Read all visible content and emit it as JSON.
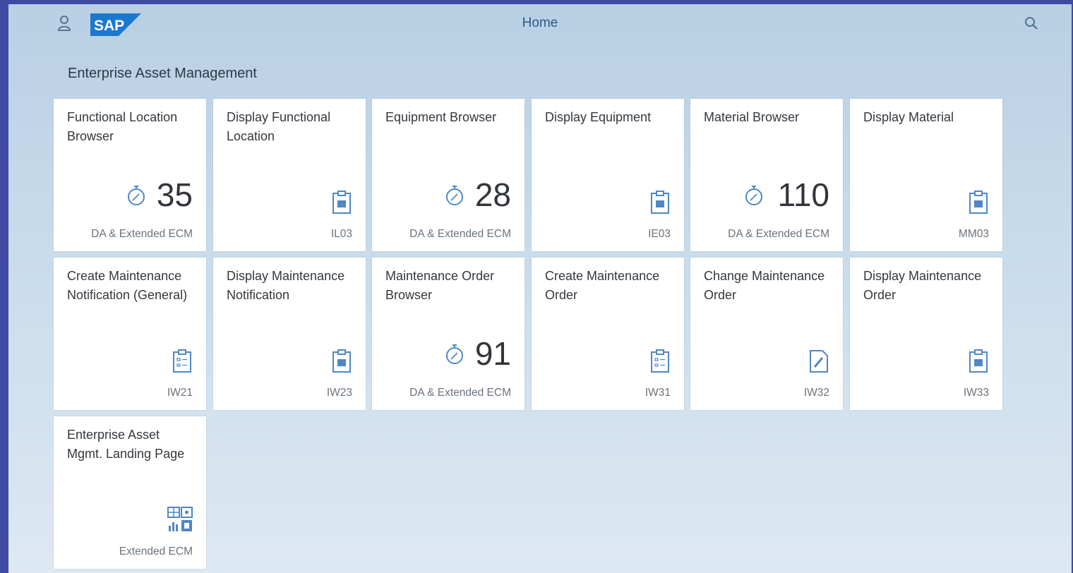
{
  "shell": {
    "title": "Home",
    "logo_text": "SAP",
    "user_icon": "user-icon",
    "search_icon": "search-icon"
  },
  "group": {
    "title": "Enterprise Asset Management"
  },
  "colors": {
    "accent": "#4a86be",
    "kpi_icon": "#4f88c2",
    "frame": "#3f4aa3",
    "logo": "#1b78d0"
  },
  "tiles": [
    {
      "title": "Functional Location Browser",
      "kpi": "35",
      "footer": "DA & Extended ECM",
      "icon": "stopwatch-icon"
    },
    {
      "title": "Display Functional Location",
      "footer": "IL03",
      "icon": "clipboard-icon"
    },
    {
      "title": "Equipment Browser",
      "kpi": "28",
      "footer": "DA & Extended ECM",
      "icon": "stopwatch-icon"
    },
    {
      "title": "Display Equipment",
      "footer": "IE03",
      "icon": "clipboard-icon"
    },
    {
      "title": "Material Browser",
      "kpi": "110",
      "footer": "DA & Extended ECM",
      "icon": "stopwatch-icon"
    },
    {
      "title": "Display Material",
      "footer": "MM03",
      "icon": "clipboard-icon"
    },
    {
      "title": "Create Maintenance Notification (General)",
      "footer": "IW21",
      "icon": "checklist-icon"
    },
    {
      "title": "Display Maintenance Notification",
      "footer": "IW23",
      "icon": "clipboard-icon"
    },
    {
      "title": "Maintenance Order Browser",
      "kpi": "91",
      "footer": "DA & Extended ECM",
      "icon": "stopwatch-icon"
    },
    {
      "title": "Create Maintenance Order",
      "footer": "IW31",
      "icon": "checklist-icon"
    },
    {
      "title": "Change Maintenance Order",
      "footer": "IW32",
      "icon": "edit-document-icon"
    },
    {
      "title": "Display Maintenance Order",
      "footer": "IW33",
      "icon": "clipboard-icon"
    },
    {
      "title": "Enterprise Asset Mgmt. Landing Page",
      "footer": "Extended ECM",
      "icon": "dashboard-icon"
    }
  ]
}
